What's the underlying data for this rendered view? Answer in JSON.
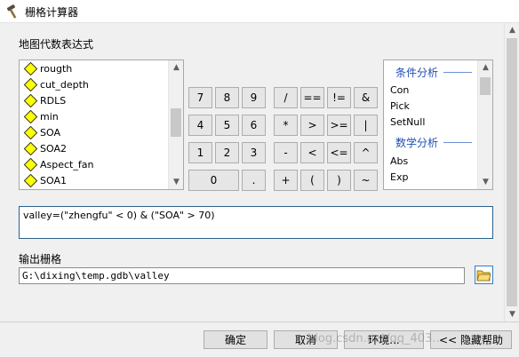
{
  "window": {
    "title": "栅格计算器",
    "icon": "hammer-icon"
  },
  "map_algebra": {
    "label": "地图代数表达式",
    "layers": [
      "rougth",
      "cut_depth",
      "RDLS",
      "min",
      "SOA",
      "SOA2",
      "Aspect_fan",
      "SOA1"
    ]
  },
  "keypad": {
    "keys": [
      "7",
      "8",
      "9",
      "/",
      "==",
      "!=",
      "&",
      "4",
      "5",
      "6",
      "*",
      ">",
      ">=",
      "|",
      "1",
      "2",
      "3",
      "-",
      "<",
      "<=",
      "^",
      "0",
      ".",
      "+",
      "(",
      ")",
      "~"
    ]
  },
  "functions": {
    "groups": [
      {
        "name": "条件分析",
        "items": [
          "Con",
          "Pick",
          "SetNull"
        ]
      },
      {
        "name": "数学分析",
        "items": [
          "Abs",
          "Exp"
        ]
      }
    ]
  },
  "expression": {
    "value": "valley=(\"zhengfu\" < 0) & (\"SOA\" > 70)"
  },
  "output": {
    "label": "输出栅格",
    "value": "G:\\dixing\\temp.gdb\\valley",
    "browse_icon": "folder-open-icon"
  },
  "footer": {
    "ok": "确定",
    "cancel": "取消",
    "env": "环境...",
    "hide_help": "<< 隐藏帮助"
  },
  "watermark": "blog.csdn.net/qq_403..."
}
